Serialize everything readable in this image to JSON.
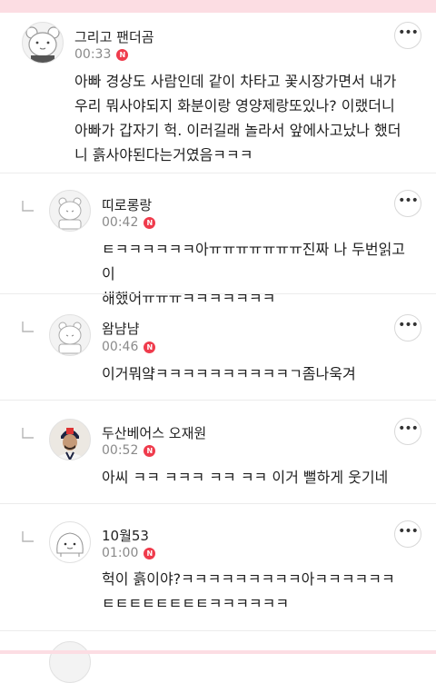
{
  "comments": [
    {
      "author": "그리고 팬더곰",
      "time": "00:33",
      "new_badge": "N",
      "more": "•••",
      "text": "아빠 경상도 사람인데 같이 차타고 꽃시장가면서 내가\n우리 뭐사야되지 화분이랑 영양제랑또있나? 이랬더니\n아빠가 갑자기 헉. 이러길래 놀라서 앞에사고났나 했더\n니 흙사야된다는거였음ㅋㅋㅋ",
      "avatar": "bear-avatar"
    },
    {
      "author": "띠로롱랑",
      "time": "00:42",
      "new_badge": "N",
      "more": "•••",
      "text": "ㅌㅋㅋㅋㅋㅋㅋ아ㅠㅠㅠㅠㅠㅠㅠ진짜 나 두번읽고 이\n해했어ㅠㅠㅠㅋㅋㅋㅋㅋㅋㅋ",
      "avatar": "default-avatar"
    },
    {
      "author": "왐냠냠",
      "time": "00:46",
      "new_badge": "N",
      "more": "•••",
      "text": "이거뭐얔ㅋㅋㅋㅋㅋㅋㅋㅋㅋㅋㄱ좀나욱겨",
      "avatar": "default-avatar"
    },
    {
      "author": "두산베어스 오재원",
      "time": "00:52",
      "new_badge": "N",
      "more": "•••",
      "text": "아씨 ㅋㅋ ㅋㅋㅋ ㅋㅋ ㅋㅋ 이거 뻘하게 웃기네",
      "avatar": "player-avatar"
    },
    {
      "author": "10월53",
      "time": "01:00",
      "new_badge": "N",
      "more": "•••",
      "text": "헉이 흙이야?ㅋㅋㅋㅋㅋㅋㅋㅋㅋ아ㅋㅋㅋㅋㅋㅋ\nㅌㅌㅌㅌㅌㅌㅌㅌㅋㅋㅋㅋㅋㅋ",
      "avatar": "cute-avatar"
    }
  ],
  "colors": {
    "badge": "#ef3b4c",
    "accent_strip": "#fcdde3",
    "time": "#8a8a8a"
  }
}
